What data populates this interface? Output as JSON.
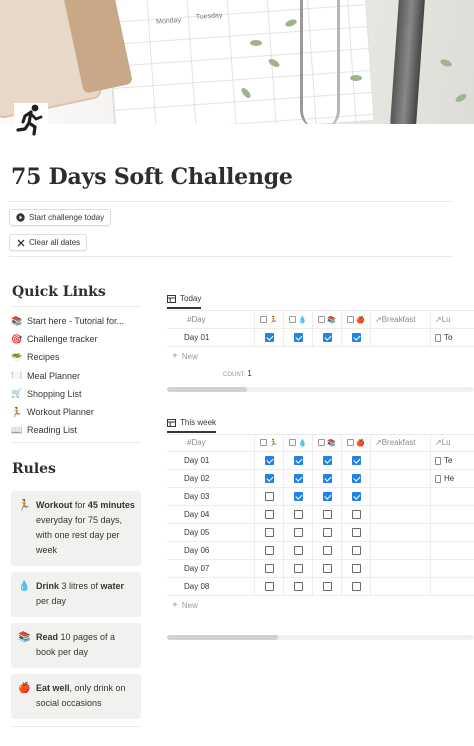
{
  "page": {
    "title": "75 Days Soft Challenge",
    "icon": "running-person-icon",
    "cover_labels": [
      "Monday",
      "Tuesday"
    ]
  },
  "buttons": {
    "start": {
      "label": "Start challenge today",
      "icon": "play-circle-icon"
    },
    "clear": {
      "label": "Clear all dates",
      "icon": "close-icon"
    }
  },
  "quick_links": {
    "heading": "Quick Links",
    "items": [
      {
        "emoji": "📚",
        "label": "Start here - Tutorial for..."
      },
      {
        "emoji": "🎯",
        "label": "Challenge tracker"
      },
      {
        "emoji": "🥗",
        "label": "Recipes"
      },
      {
        "emoji": "🍽️",
        "label": "Meal Planner"
      },
      {
        "emoji": "🛒",
        "label": "Shopping List"
      },
      {
        "emoji": "🏃",
        "label": "Workout Planner"
      },
      {
        "emoji": "📖",
        "label": "Reading List"
      }
    ]
  },
  "rules": {
    "heading": "Rules",
    "items": [
      {
        "emoji": "🏃",
        "bold1": "Workout",
        "text1": " for ",
        "bold2": "45 minutes",
        "text2": " everyday for 75 days, with one rest day per week"
      },
      {
        "emoji": "💧",
        "bold1": "Drink",
        "text1": " 3 litres of ",
        "bold2": "water",
        "text2": " per day"
      },
      {
        "emoji": "📚",
        "bold1": "Read",
        "text1": " 10 pages of a book per day",
        "bold2": "",
        "text2": ""
      },
      {
        "emoji": "🍎",
        "bold1": "Eat well",
        "text1": ", only drink on social occasions",
        "bold2": "",
        "text2": ""
      }
    ]
  },
  "today_view": {
    "tab_label": "Today",
    "columns": {
      "day": "Day",
      "check_icons": [
        "🏃",
        "💧",
        "📚",
        "🍎"
      ],
      "breakfast": "Breakfast",
      "lunch": "Lu"
    },
    "rows": [
      {
        "day": "Day 01",
        "checks": [
          true,
          true,
          true,
          true
        ],
        "lunch": "To"
      }
    ],
    "new_label": "New",
    "count_label": "COUNT",
    "count_value": "1",
    "scroll_fraction": 0.26
  },
  "week_view": {
    "tab_label": "This week",
    "columns": {
      "day": "Day",
      "check_icons": [
        "🏃",
        "💧",
        "📚",
        "🍎"
      ],
      "breakfast": "Breakfast",
      "lunch": "Lu"
    },
    "rows": [
      {
        "day": "Day 01",
        "checks": [
          true,
          true,
          true,
          true
        ],
        "lunch": "Te"
      },
      {
        "day": "Day 02",
        "checks": [
          true,
          true,
          true,
          true
        ],
        "lunch": "He"
      },
      {
        "day": "Day 03",
        "checks": [
          false,
          true,
          true,
          true
        ],
        "lunch": ""
      },
      {
        "day": "Day 04",
        "checks": [
          false,
          false,
          false,
          false
        ],
        "lunch": ""
      },
      {
        "day": "Day 05",
        "checks": [
          false,
          false,
          false,
          false
        ],
        "lunch": ""
      },
      {
        "day": "Day 06",
        "checks": [
          false,
          false,
          false,
          false
        ],
        "lunch": ""
      },
      {
        "day": "Day 07",
        "checks": [
          false,
          false,
          false,
          false
        ],
        "lunch": ""
      },
      {
        "day": "Day 08",
        "checks": [
          false,
          false,
          false,
          false
        ],
        "lunch": ""
      }
    ],
    "new_label": "New",
    "scroll_fraction": 0.36
  },
  "colors": {
    "checkbox_on": "#2383e2",
    "rule_bg": "#f1f1ef",
    "text": "#37352f"
  }
}
